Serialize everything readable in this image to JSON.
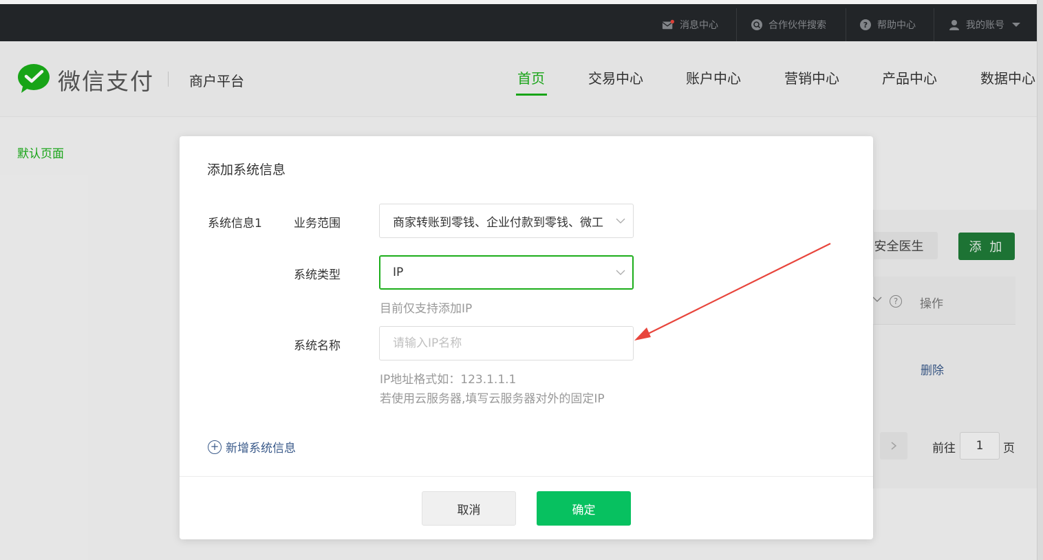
{
  "topbar": {
    "items": [
      {
        "label": "消息中心",
        "icon": "mail-icon"
      },
      {
        "label": "合作伙伴搜索",
        "icon": "partner-search-icon"
      },
      {
        "label": "帮助中心",
        "icon": "help-icon"
      },
      {
        "label": "我的账号",
        "icon": "user-icon"
      }
    ]
  },
  "header": {
    "brand": "微信支付",
    "subbrand": "商户平台",
    "nav": [
      "首页",
      "交易中心",
      "账户中心",
      "营销中心",
      "产品中心",
      "数据中心"
    ],
    "active_nav": "首页"
  },
  "sidebar": {
    "default_page": "默认页面"
  },
  "background": {
    "doctor_button": "安全医生",
    "add_button": "添 加",
    "operation_header": "操作",
    "delete_link": "删除",
    "pager_goto": "前往",
    "pager_page": "1",
    "pager_unit": "页"
  },
  "modal": {
    "title": "添加系统信息",
    "group_label": "系统信息1",
    "business_scope": {
      "label": "业务范围",
      "value": "商家转账到零钱、企业付款到零钱、微工"
    },
    "system_type": {
      "label": "系统类型",
      "value": "IP",
      "hint": "目前仅支持添加IP"
    },
    "system_name": {
      "label": "系统名称",
      "placeholder": "请输入IP名称",
      "hint1": "IP地址格式如：123.1.1.1",
      "hint2": "若使用云服务器,填写云服务器对外的固定IP"
    },
    "add_more": "新增系统信息",
    "cancel": "取消",
    "confirm": "确定"
  },
  "colors": {
    "brand_green": "#1aad19",
    "confirm_green": "#07c160",
    "annotation_red": "#e8453c"
  }
}
